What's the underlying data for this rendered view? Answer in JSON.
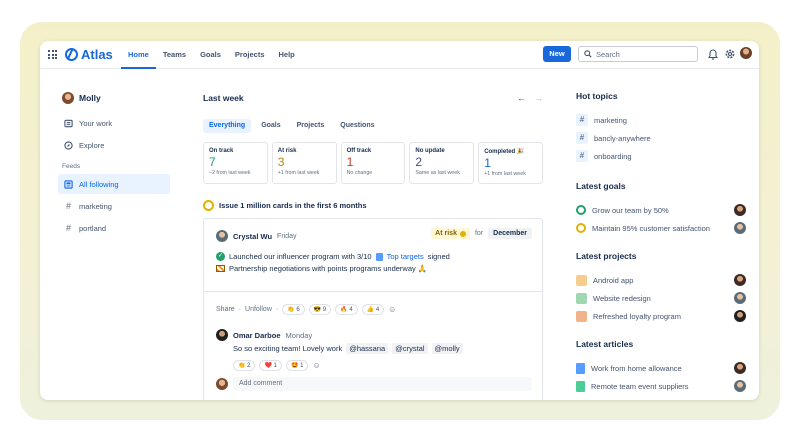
{
  "app": {
    "name": "Atlas"
  },
  "nav": {
    "items": [
      {
        "label": "Home",
        "active": true
      },
      {
        "label": "Teams"
      },
      {
        "label": "Goals"
      },
      {
        "label": "Projects"
      },
      {
        "label": "Help"
      }
    ]
  },
  "toolbar": {
    "new_label": "New",
    "search_placeholder": "Search"
  },
  "icons": {
    "apps": "grid-icon",
    "notifications": "bell-icon",
    "settings": "gear-icon"
  },
  "colors": {
    "accent": "#1868db",
    "at_risk": "#e2b203",
    "on_track": "#22a06b"
  },
  "sidebar": {
    "user": "Molly",
    "items": [
      {
        "label": "Your work"
      },
      {
        "label": "Explore"
      }
    ],
    "feeds_heading": "Feeds",
    "feeds": [
      {
        "label": "All following",
        "selected": true
      },
      {
        "label": "marketing"
      },
      {
        "label": "portland"
      }
    ]
  },
  "main": {
    "title": "Last week",
    "filters": [
      "Everything",
      "Goals",
      "Projects",
      "Questions"
    ],
    "stats": [
      {
        "label": "On track",
        "value": "7",
        "sub": "–2 from last week",
        "color": "#22a06b"
      },
      {
        "label": "At risk",
        "value": "3",
        "sub": "+1 from last week",
        "color": "#b38600"
      },
      {
        "label": "Off track",
        "value": "1",
        "sub": "No change",
        "color": "#c9372c"
      },
      {
        "label": "No update",
        "value": "2",
        "sub": "Same as last week",
        "color": "#44546f"
      },
      {
        "label": "Completed 🎉",
        "value": "1",
        "sub": "+1 from last week",
        "color": "#0c66e4"
      }
    ],
    "goal": "Issue 1 million cards in the first 6 months",
    "post": {
      "author": "Crystal Wu",
      "day": "Friday",
      "status": "At risk",
      "for_label": "for",
      "month": "December",
      "line1_prefix": "Launched our influencer program with 3/10",
      "line1_link": "Top targets",
      "line1_suffix": "signed",
      "line2": "Partnership negotiations with points programs underway 🙏",
      "share": "Share",
      "unfollow": "Unfollow",
      "reactions": [
        "👏 6",
        "😎 9",
        "🔥 4",
        "👍 4"
      ]
    },
    "reply": {
      "author": "Omar Darboe",
      "day": "Monday",
      "text": "So so exciting team! Lovely work",
      "mentions": [
        "@hassana",
        "@crystal",
        "@molly"
      ],
      "reactions": [
        "👏 2",
        "❤️ 1",
        "🤩 1"
      ]
    },
    "comment_placeholder": "Add comment"
  },
  "right": {
    "hot_topics_title": "Hot topics",
    "hot_topics": [
      "marketing",
      "bancly-anywhere",
      "onboarding"
    ],
    "goals_title": "Latest goals",
    "goals": [
      {
        "label": "Grow our team by 50%",
        "status_color": "#22a06b"
      },
      {
        "label": "Maintain 95% customer satisfaction",
        "status_color": "#e2b203"
      }
    ],
    "projects_title": "Latest projects",
    "projects": [
      {
        "label": "Android app",
        "icon": "android-icon",
        "color": "#f5cd8f"
      },
      {
        "label": "Website redesign",
        "icon": "globe-icon",
        "color": "#9fd7b0"
      },
      {
        "label": "Refreshed loyalty program",
        "icon": "cake-icon",
        "color": "#f0b38a"
      }
    ],
    "articles_title": "Latest articles",
    "articles": [
      {
        "label": "Work from home allowance",
        "color": "#579dff"
      },
      {
        "label": "Remote team event suppliers",
        "color": "#4bce97"
      }
    ]
  }
}
